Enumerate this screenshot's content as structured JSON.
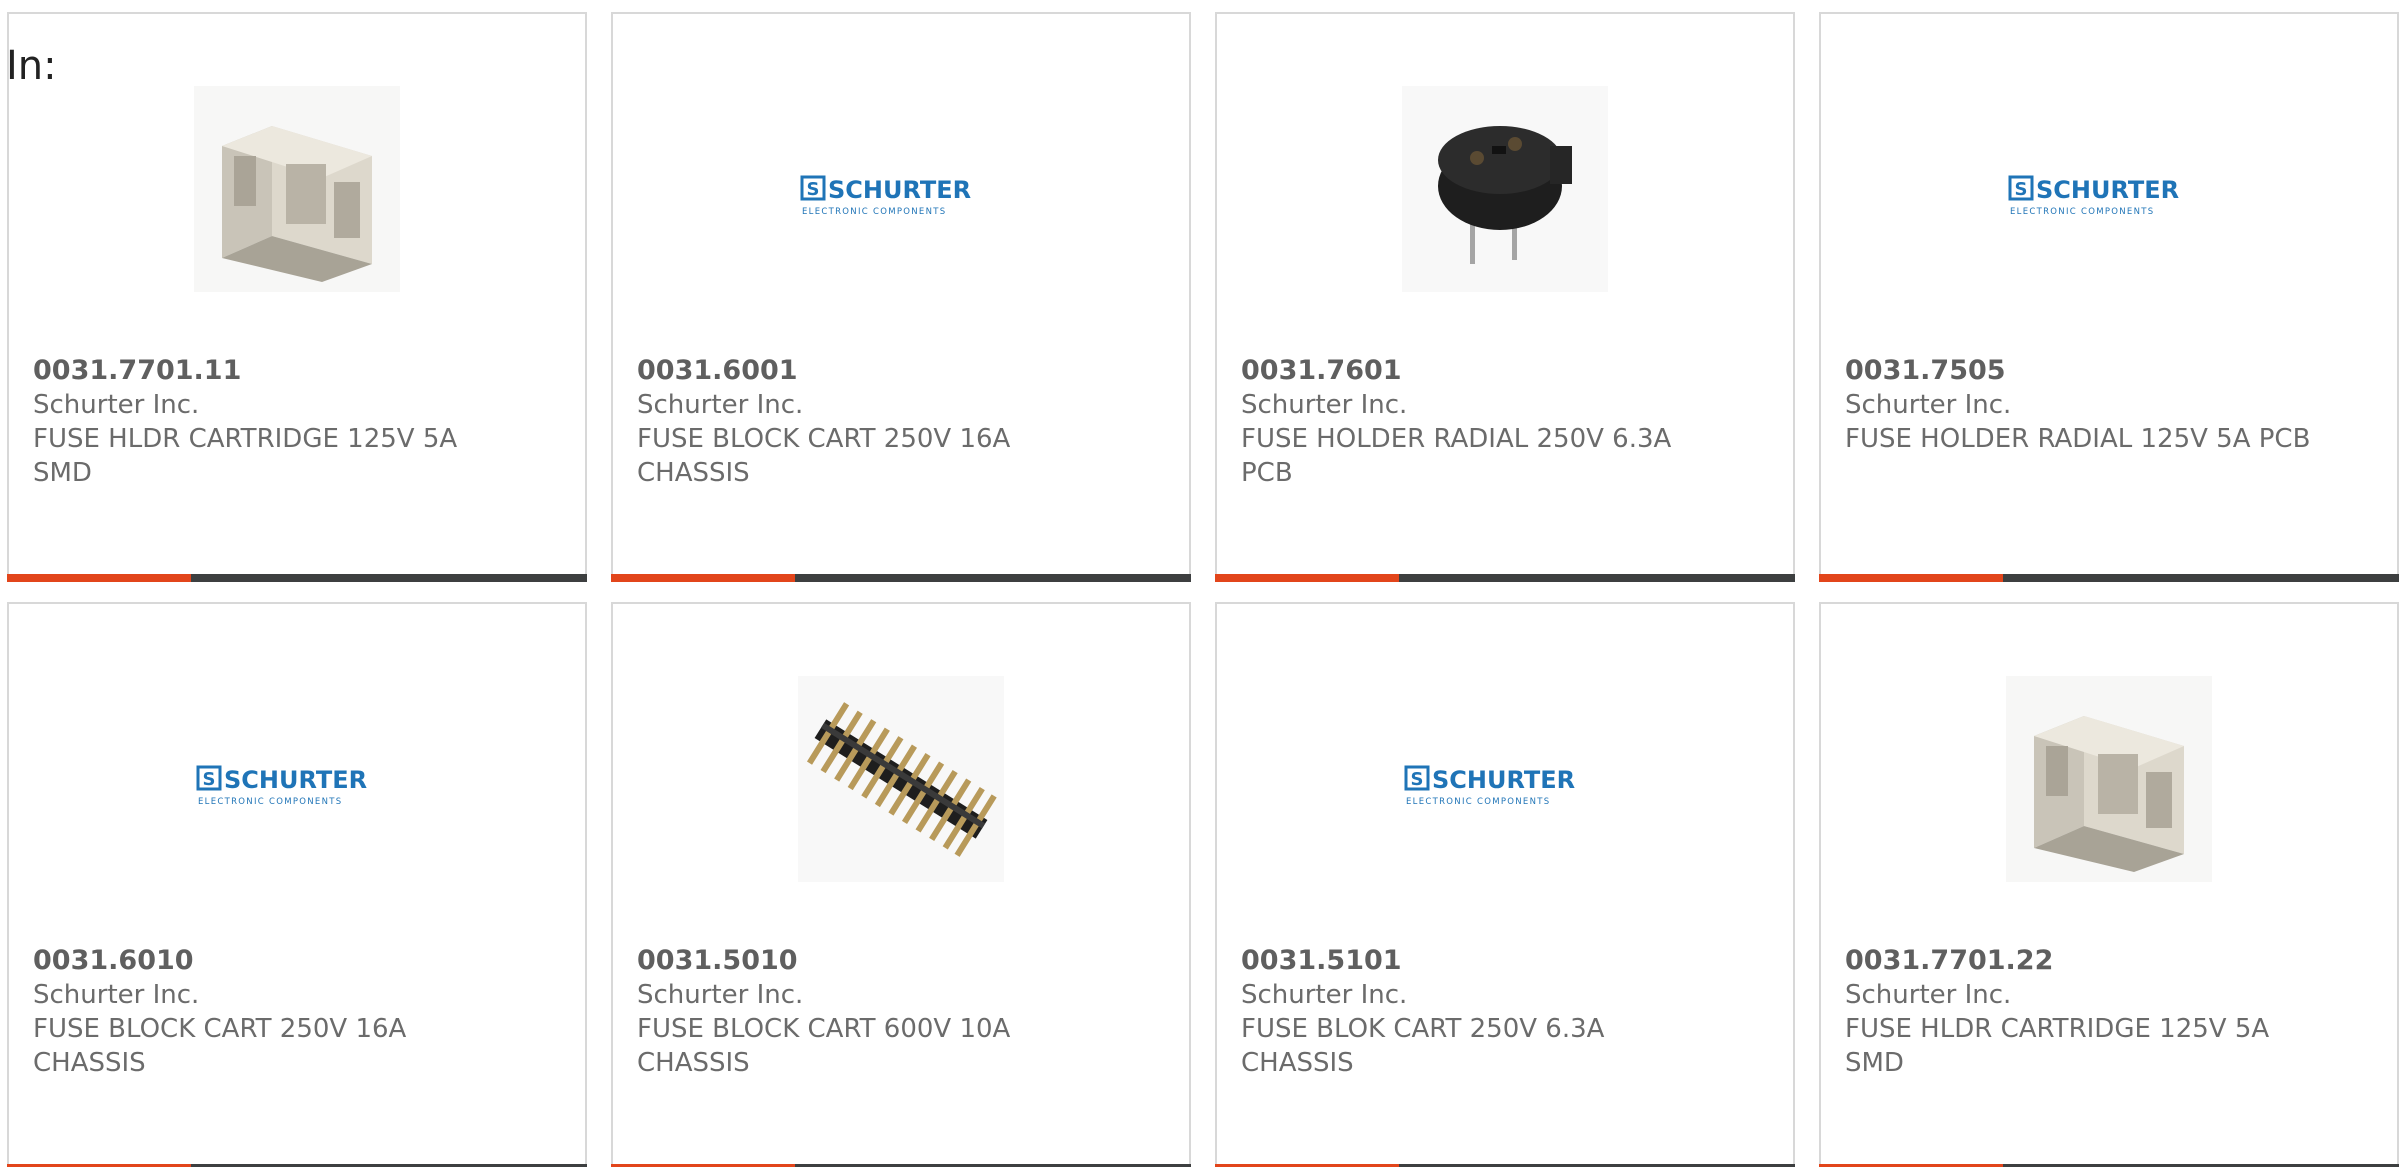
{
  "filter_label": "In:",
  "colors": {
    "accent": "#e2451b",
    "bar": "#3d3f40",
    "text": "#6b6b6b",
    "brand_blue": "#1f74b7"
  },
  "products": [
    {
      "part_number": "0031.7701.11",
      "manufacturer": "Schurter Inc.",
      "description": "FUSE HLDR CARTRIDGE 125V 5A SMD",
      "image": "fuse-holder-cartridge-photo"
    },
    {
      "part_number": "0031.6001",
      "manufacturer": "Schurter Inc.",
      "description": "FUSE BLOCK CART 250V 16A CHASSIS",
      "image": "schurter-logo"
    },
    {
      "part_number": "0031.7601",
      "manufacturer": "Schurter Inc.",
      "description": "FUSE HOLDER RADIAL 250V 6.3A PCB",
      "image": "radial-fuse-holder-photo"
    },
    {
      "part_number": "0031.7505",
      "manufacturer": "Schurter Inc.",
      "description": "FUSE HOLDER RADIAL 125V 5A PCB",
      "image": "schurter-logo"
    },
    {
      "part_number": "0031.6010",
      "manufacturer": "Schurter Inc.",
      "description": "FUSE BLOCK CART 250V 16A CHASSIS",
      "image": "schurter-logo"
    },
    {
      "part_number": "0031.5010",
      "manufacturer": "Schurter Inc.",
      "description": "FUSE BLOCK CART 600V 10A CHASSIS",
      "image": "pin-header-photo"
    },
    {
      "part_number": "0031.5101",
      "manufacturer": "Schurter Inc.",
      "description": "FUSE BLOK CART 250V 6.3A CHASSIS",
      "image": "schurter-logo"
    },
    {
      "part_number": "0031.7701.22",
      "manufacturer": "Schurter Inc.",
      "description": "FUSE HLDR CARTRIDGE 125V 5A SMD",
      "image": "fuse-holder-cartridge-photo"
    }
  ],
  "logo": {
    "brand": "SCHURTER",
    "tagline": "ELECTRONIC COMPONENTS"
  }
}
